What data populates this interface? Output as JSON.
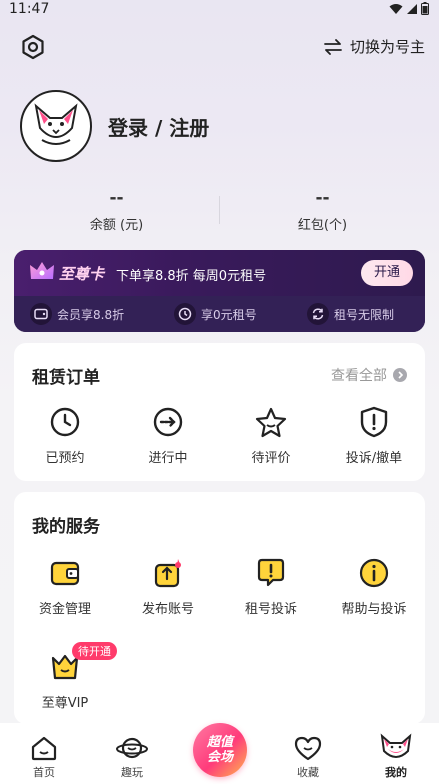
{
  "status_bar": {
    "time": "11:47"
  },
  "header": {
    "switch_label": "切换为号主"
  },
  "profile": {
    "login_label": "登录 / 注册"
  },
  "stats": [
    {
      "value": "--",
      "label": "余额 (元)"
    },
    {
      "value": "--",
      "label": "红包(个)"
    }
  ],
  "vip_card": {
    "title": "至尊卡",
    "description": "下单享8.8折 每周0元租号",
    "open_button": "开通",
    "perks": [
      "会员享8.8折",
      "享0元租号",
      "租号无限制"
    ]
  },
  "rental_orders": {
    "title": "租赁订单",
    "view_all": "查看全部",
    "items": [
      {
        "label": "已预约",
        "icon": "clock-icon"
      },
      {
        "label": "进行中",
        "icon": "arrow-right-circle-icon"
      },
      {
        "label": "待评价",
        "icon": "star-icon"
      },
      {
        "label": "投诉/撤单",
        "icon": "shield-alert-icon"
      }
    ]
  },
  "my_services": {
    "title": "我的服务",
    "items": [
      {
        "label": "资金管理",
        "icon": "wallet-icon"
      },
      {
        "label": "发布账号",
        "icon": "publish-icon"
      },
      {
        "label": "租号投诉",
        "icon": "complaint-icon"
      },
      {
        "label": "帮助与投诉",
        "icon": "info-icon"
      },
      {
        "label": "至尊VIP",
        "icon": "crown-icon",
        "badge": "待开通"
      }
    ]
  },
  "tab_bar": {
    "tabs": [
      {
        "label": "首页",
        "icon": "home-icon"
      },
      {
        "label": "趣玩",
        "icon": "planet-icon"
      },
      {
        "label": "超值会场",
        "icon": "center-promo-icon"
      },
      {
        "label": "收藏",
        "icon": "heart-icon"
      },
      {
        "label": "我的",
        "icon": "mascot-icon",
        "active": true
      }
    ],
    "center_line1": "超值",
    "center_line2": "会场"
  },
  "colors": {
    "accent": "#ff3b6b",
    "vip_bg": "#2a1a4a",
    "icon_yellow": "#ffd43b"
  }
}
